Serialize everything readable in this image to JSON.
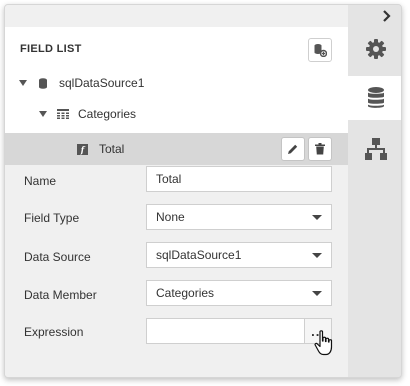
{
  "header": {
    "title": "FIELD LIST",
    "icon": "add-calculated-field-icon"
  },
  "tree": {
    "datasource": {
      "label": "sqlDataSource1",
      "icon": "database-icon",
      "expanded": true
    },
    "table": {
      "label": "Categories",
      "icon": "table-icon",
      "expanded": true
    },
    "field": {
      "label": "Total",
      "icon": "calculated-field-icon",
      "selected": true
    }
  },
  "field_actions": {
    "edit_icon": "pencil-icon",
    "delete_icon": "trash-icon"
  },
  "properties": [
    {
      "label": "Name",
      "value": "Total",
      "type": "text"
    },
    {
      "label": "Field Type",
      "value": "None",
      "type": "dropdown"
    },
    {
      "label": "Data Source",
      "value": "sqlDataSource1",
      "type": "dropdown"
    },
    {
      "label": "Data Member",
      "value": "Categories",
      "type": "dropdown"
    },
    {
      "label": "Expression",
      "value": "",
      "type": "ellipsis",
      "button_label": "..."
    }
  ],
  "side_tabs": [
    {
      "name": "properties",
      "icon": "gear-icon",
      "active": false
    },
    {
      "name": "field-list",
      "icon": "database-icon",
      "active": true
    },
    {
      "name": "report-explorer",
      "icon": "hierarchy-icon",
      "active": false
    }
  ],
  "colors": {
    "panel_bg": "#f0f0f0",
    "selected_row": "#d7d7d7",
    "tab_strip": "#e4e4e4",
    "icon": "#555555"
  }
}
